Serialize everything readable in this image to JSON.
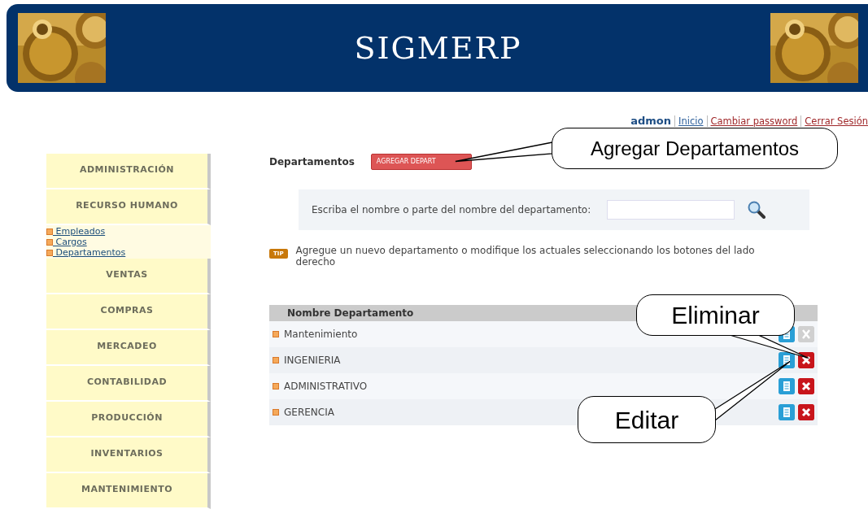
{
  "header": {
    "title": "SIGMERP"
  },
  "user_bar": {
    "user": "admon",
    "links": [
      {
        "label": "Inicio",
        "kind": "nav"
      },
      {
        "label": "Cambiar password",
        "kind": "action"
      },
      {
        "label": "Cerrar Sesión",
        "kind": "action"
      }
    ]
  },
  "sidebar": {
    "items": [
      {
        "label": "ADMINISTRACIÓN"
      },
      {
        "label": "RECURSO HUMANO",
        "children": [
          {
            "label": " Empleados"
          },
          {
            "label": " Cargos"
          },
          {
            "label": " Departamentos"
          }
        ]
      },
      {
        "label": "VENTAS"
      },
      {
        "label": "COMPRAS"
      },
      {
        "label": "MERCADEO"
      },
      {
        "label": "CONTABILIDAD"
      },
      {
        "label": "PRODUCCIÓN"
      },
      {
        "label": "INVENTARIOS"
      },
      {
        "label": "MANTENIMIENTO"
      }
    ]
  },
  "page": {
    "title": "Departamentos",
    "add_button": "AGREGAR DEPART"
  },
  "search": {
    "label": "Escriba el nombre o parte del nombre del departamento:"
  },
  "tip": {
    "badge": "TIP",
    "text": "Agregue un nuevo departamento o modifique los actuales seleccionando los botones del lado derecho"
  },
  "table": {
    "columns": [
      "Nombre Departamento"
    ],
    "rows": [
      {
        "name": "Mantenimiento",
        "delete_disabled": true
      },
      {
        "name": "INGENIERIA",
        "delete_disabled": false
      },
      {
        "name": "ADMINISTRATIVO",
        "delete_disabled": false
      },
      {
        "name": "GERENCIA",
        "delete_disabled": false
      }
    ]
  },
  "callouts": [
    {
      "text": "Agregar Departamentos"
    },
    {
      "text": "Eliminar"
    },
    {
      "text": "Editar"
    }
  ]
}
